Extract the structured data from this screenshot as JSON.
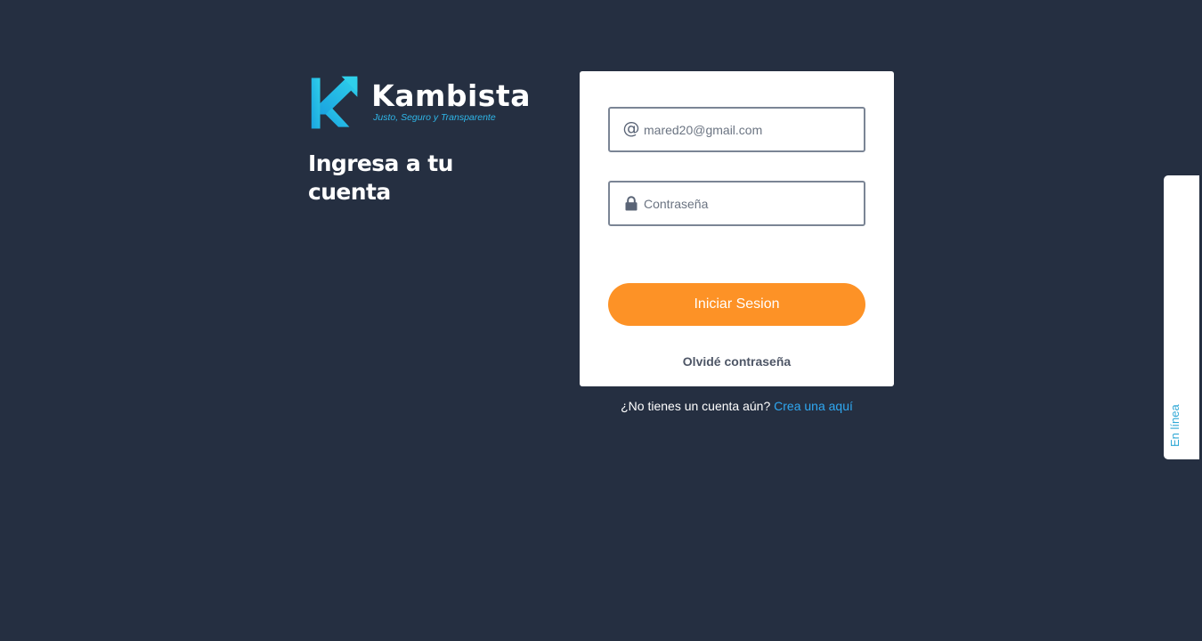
{
  "brand": {
    "name": "Kambista",
    "tagline": "Justo, Seguro y Transparente",
    "accent_color": "#2fb6e8"
  },
  "heading": "Ingresa a tu cuenta",
  "form": {
    "email": {
      "icon": "at-icon",
      "value": "mared20@gmail.com"
    },
    "password": {
      "icon": "lock-icon",
      "placeholder": "Contraseña"
    },
    "submit_label": "Iniciar Sesion",
    "submit_color": "#fd9226",
    "forgot_label": "Olvidé contraseña"
  },
  "signup": {
    "prompt": "¿No tienes un cuenta aún?",
    "link_label": "Crea una aquí",
    "link_color": "#2fa8f2"
  },
  "chat_tab": {
    "label": "En línea"
  },
  "colors": {
    "background": "#252f41",
    "card": "#ffffff"
  }
}
